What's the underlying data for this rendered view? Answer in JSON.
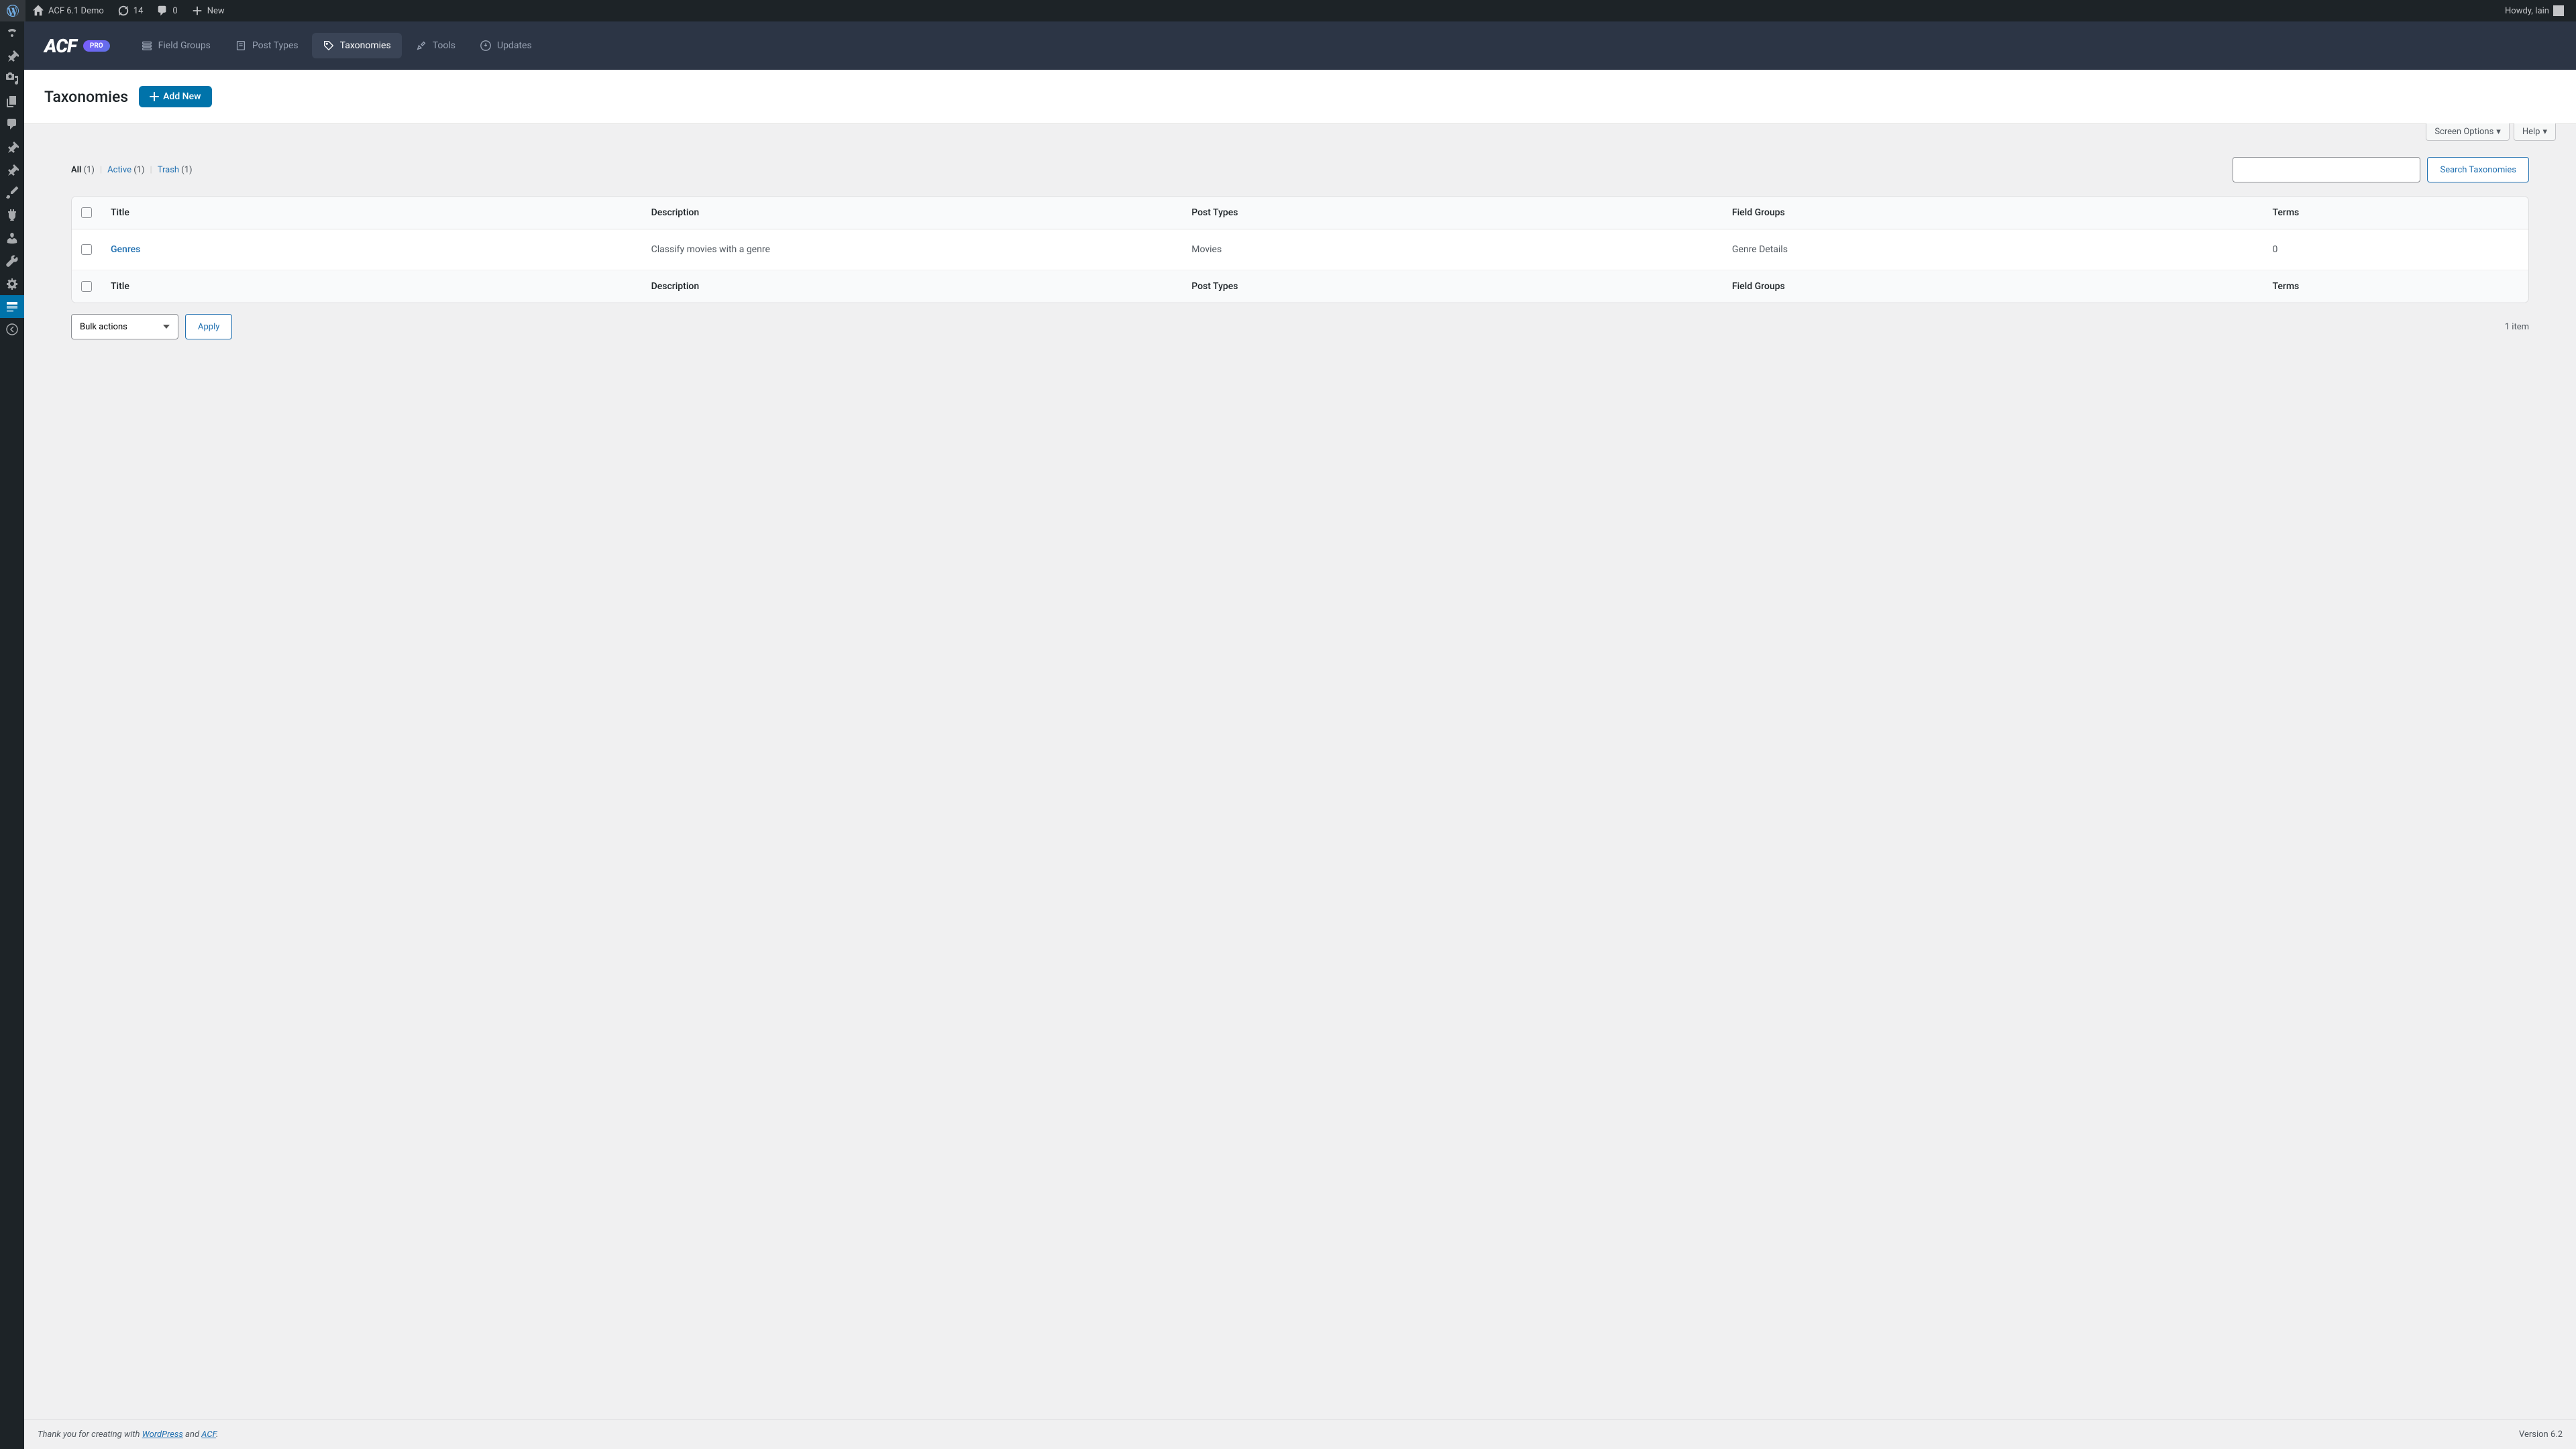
{
  "toolbar": {
    "site_name": "ACF 6.1 Demo",
    "updates_count": "14",
    "comments_count": "0",
    "new_label": "New",
    "howdy": "Howdy, Iain"
  },
  "acf_nav": {
    "pro_badge": "PRO",
    "tabs": {
      "field_groups": "Field Groups",
      "post_types": "Post Types",
      "taxonomies": "Taxonomies",
      "tools": "Tools",
      "updates": "Updates"
    }
  },
  "page": {
    "title": "Taxonomies",
    "add_new": "Add New",
    "screen_options": "Screen Options",
    "help": "Help"
  },
  "filters": {
    "all": "All",
    "all_count": "(1)",
    "active": "Active",
    "active_count": "(1)",
    "trash": "Trash",
    "trash_count": "(1)",
    "search_btn": "Search Taxonomies"
  },
  "table": {
    "headers": {
      "title": "Title",
      "description": "Description",
      "post_types": "Post Types",
      "field_groups": "Field Groups",
      "terms": "Terms"
    },
    "row": {
      "title": "Genres",
      "description": "Classify movies with a genre",
      "post_types": "Movies",
      "field_groups": "Genre Details",
      "terms": "0"
    }
  },
  "bulk": {
    "actions": "Bulk actions",
    "apply": "Apply",
    "count": "1 item"
  },
  "footer": {
    "thanks_prefix": "Thank you for creating with ",
    "wp": "WordPress",
    "and": " and ",
    "acf": "ACF",
    "period": ".",
    "version": "Version 6.2"
  }
}
